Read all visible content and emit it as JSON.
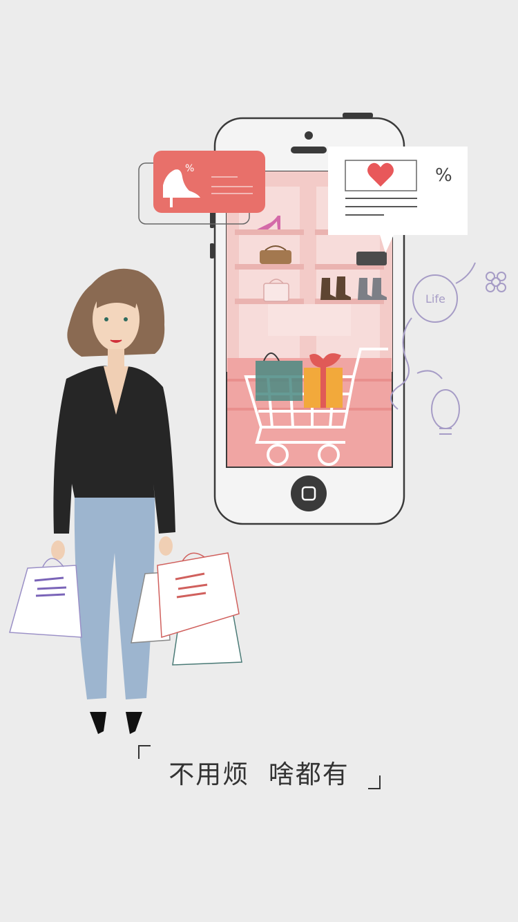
{
  "slogan": {
    "text": "不用烦  啥都有"
  },
  "card_left": {
    "badge": "%"
  },
  "card_right": {
    "badge": "%"
  },
  "doodle": {
    "label": "Life"
  },
  "colors": {
    "background": "#ececec",
    "accent_coral": "#e8706a",
    "phone_outline": "#3a3a3a",
    "screen_pink": "#f3c7c5",
    "doodle_purple": "#a69cc6"
  }
}
